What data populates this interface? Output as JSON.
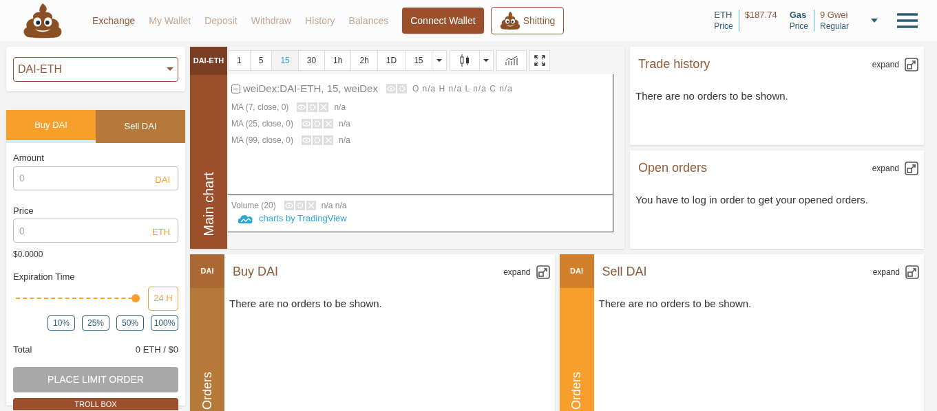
{
  "nav": {
    "items": [
      {
        "label": "Exchange",
        "selected": true
      },
      {
        "label": "My Wallet",
        "selected": false
      },
      {
        "label": "Deposit",
        "selected": false
      },
      {
        "label": "Withdraw",
        "selected": false
      },
      {
        "label": "History",
        "selected": false
      },
      {
        "label": "Balances",
        "selected": false
      }
    ],
    "connect_button": "Connect Wallet",
    "account_button": "Shitting"
  },
  "stats": [
    {
      "label": "ETH",
      "sublabel": "Price",
      "value": "$187.74"
    },
    {
      "label": "Gas",
      "sublabel": "Price",
      "value": "9 Gwei",
      "subvalue": "Regular"
    }
  ],
  "pair_select": {
    "value": "DAI-ETH"
  },
  "order_form": {
    "tabs": [
      {
        "label": "Buy DAI",
        "selected": true
      },
      {
        "label": "Sell DAI",
        "selected": false
      }
    ],
    "amount": {
      "label": "Amount",
      "placeholder": "0",
      "unit": "DAI"
    },
    "price": {
      "label": "Price",
      "placeholder": "0",
      "unit": "ETH"
    },
    "price_usd": "$0.0000",
    "expiration": {
      "label": "Expiration Time",
      "level": 1.0,
      "value": "24 H"
    },
    "percent_buttons": [
      "10%",
      "25%",
      "50%",
      "100%"
    ],
    "total": {
      "label": "Total",
      "value": "0 ETH / $0"
    },
    "place_button": "PLACE LIMIT ORDER",
    "troll_box_button": "TROLL BOX"
  },
  "main_chart": {
    "pair": "DAI-ETH",
    "side_label": "Main chart",
    "intervals": [
      {
        "label": "1",
        "selected": false
      },
      {
        "label": "5",
        "selected": false
      },
      {
        "label": "15",
        "selected": true
      },
      {
        "label": "30",
        "selected": false
      },
      {
        "label": "1h",
        "selected": false
      },
      {
        "label": "2h",
        "selected": false
      },
      {
        "label": "1D",
        "selected": false
      },
      {
        "label": "15",
        "selected": false
      }
    ],
    "title": "weiDex:DAI-ETH, 15, weiDex",
    "ohlc": "O n/a H n/a L n/a C n/a",
    "indicators": [
      {
        "label": "MA (7, close, 0)",
        "value": "n/a"
      },
      {
        "label": "MA (25, close, 0)",
        "value": "n/a"
      },
      {
        "label": "MA (99, close, 0)",
        "value": "n/a"
      }
    ],
    "volume": {
      "label": "Volume (20)",
      "value": "n/a n/a"
    },
    "credit": "charts by TradingView"
  },
  "trade_history": {
    "title": "Trade history",
    "expand": "expand",
    "message": "There are no orders to be shown."
  },
  "open_orders": {
    "title": "Open orders",
    "expand": "expand",
    "message": "You have to log in order to get your opened orders."
  },
  "order_books": [
    {
      "token": "DAI",
      "side_label": "Orders",
      "title": "Buy DAI",
      "expand": "expand",
      "message": "There are no orders to be shown.",
      "color": "#b5793a"
    },
    {
      "token": "DAI",
      "side_label": "Orders",
      "title": "Sell DAI",
      "expand": "expand",
      "message": "There are no orders to be shown.",
      "color": "#f79f2a"
    }
  ]
}
